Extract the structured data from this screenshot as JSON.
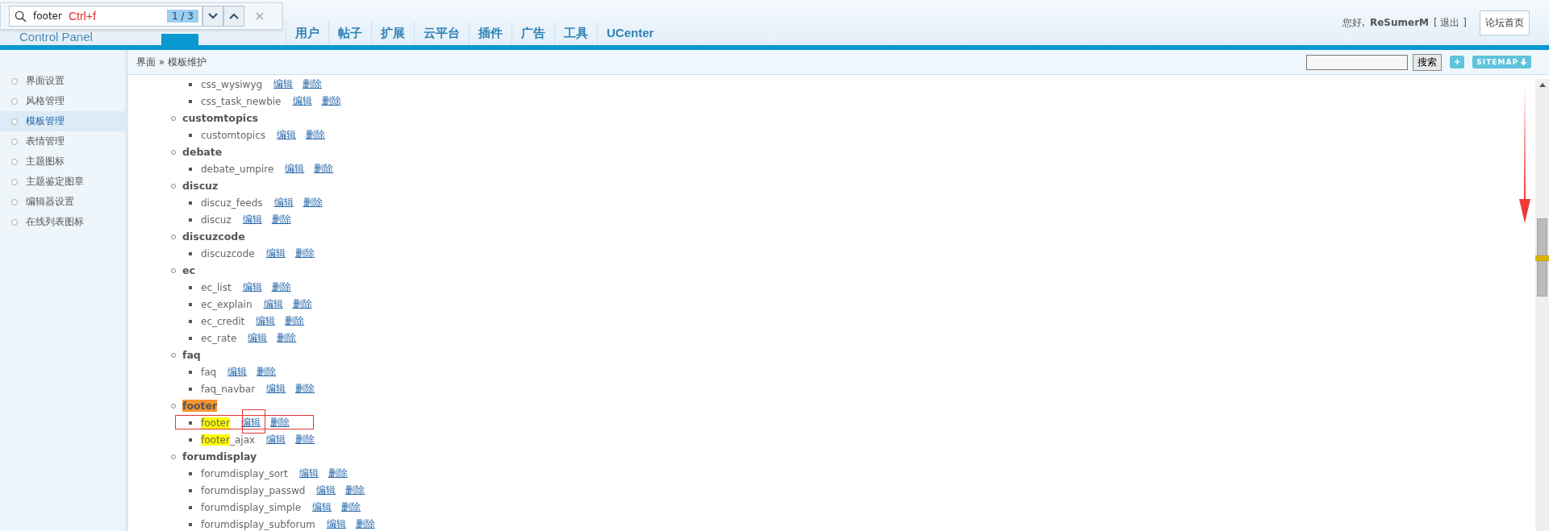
{
  "find_bar": {
    "query": "footer",
    "annotation": "Ctrl+f",
    "match_count": "1 / 3"
  },
  "header": {
    "logo_subtitle": "Control Panel",
    "greeting": "您好,",
    "username": "ReSumerM",
    "logout": "[ 退出 ]",
    "home_button": "论坛首页"
  },
  "nav_tabs": [
    {
      "label": "用户",
      "selected": false
    },
    {
      "label": "帖子",
      "selected": false
    },
    {
      "label": "扩展",
      "selected": false
    },
    {
      "label": "云平台",
      "selected": false
    },
    {
      "label": "插件",
      "selected": false
    },
    {
      "label": "广告",
      "selected": false
    },
    {
      "label": "工具",
      "selected": false
    },
    {
      "label": "UCenter",
      "selected": false
    }
  ],
  "breadcrumb": "界面 » 模板维护",
  "toolbar": {
    "search_button": "搜索",
    "add_button": "+",
    "sitemap_button": "SITEMAP"
  },
  "sidebar": {
    "items": [
      {
        "label": "界面设置",
        "selected": false
      },
      {
        "label": "风格管理",
        "selected": false
      },
      {
        "label": "模板管理",
        "selected": true
      },
      {
        "label": "表情管理",
        "selected": false
      },
      {
        "label": "主题图标",
        "selected": false
      },
      {
        "label": "主题鉴定图章",
        "selected": false
      },
      {
        "label": "编辑器设置",
        "selected": false
      },
      {
        "label": "在线列表图标",
        "selected": false
      }
    ]
  },
  "template_groups": [
    {
      "children": [
        {
          "parts": [
            {
              "text": "css_wysiwyg"
            }
          ],
          "actions": [
            "编辑",
            "删除"
          ]
        },
        {
          "parts": [
            {
              "text": "css_task_newbie"
            }
          ],
          "actions": [
            "编辑",
            "删除"
          ]
        }
      ]
    },
    {
      "parts": [
        {
          "text": "customtopics"
        }
      ],
      "children": [
        {
          "parts": [
            {
              "text": "customtopics"
            }
          ],
          "actions": [
            "编辑",
            "删除"
          ]
        }
      ]
    },
    {
      "parts": [
        {
          "text": "debate"
        }
      ],
      "children": [
        {
          "parts": [
            {
              "text": "debate_umpire"
            }
          ],
          "actions": [
            "编辑",
            "删除"
          ]
        }
      ]
    },
    {
      "parts": [
        {
          "text": "discuz"
        }
      ],
      "children": [
        {
          "parts": [
            {
              "text": "discuz_feeds"
            }
          ],
          "actions": [
            "编辑",
            "删除"
          ]
        },
        {
          "parts": [
            {
              "text": "discuz"
            }
          ],
          "actions": [
            "编辑",
            "删除"
          ]
        }
      ]
    },
    {
      "parts": [
        {
          "text": "discuzcode"
        }
      ],
      "children": [
        {
          "parts": [
            {
              "text": "discuzcode"
            }
          ],
          "actions": [
            "编辑",
            "删除"
          ]
        }
      ]
    },
    {
      "parts": [
        {
          "text": "ec"
        }
      ],
      "children": [
        {
          "parts": [
            {
              "text": "ec_list"
            }
          ],
          "actions": [
            "编辑",
            "删除"
          ]
        },
        {
          "parts": [
            {
              "text": "ec_explain"
            }
          ],
          "actions": [
            "编辑",
            "删除"
          ]
        },
        {
          "parts": [
            {
              "text": "ec_credit"
            }
          ],
          "actions": [
            "编辑",
            "删除"
          ]
        },
        {
          "parts": [
            {
              "text": "ec_rate"
            }
          ],
          "actions": [
            "编辑",
            "删除"
          ]
        }
      ]
    },
    {
      "parts": [
        {
          "text": "faq"
        }
      ],
      "children": [
        {
          "parts": [
            {
              "text": "faq"
            }
          ],
          "actions": [
            "编辑",
            "删除"
          ]
        },
        {
          "parts": [
            {
              "text": "faq_navbar"
            }
          ],
          "actions": [
            "编辑",
            "删除"
          ]
        }
      ]
    },
    {
      "parts": [
        {
          "text": "footer",
          "match": true,
          "current": true
        }
      ],
      "children": [
        {
          "parts": [
            {
              "text": "footer",
              "match": true,
              "current": false
            }
          ],
          "actions": [
            "编辑",
            "删除"
          ],
          "annotated": true,
          "edit_annotated": true
        },
        {
          "parts": [
            {
              "text": "footer",
              "match": true,
              "current": false
            },
            {
              "text": "_ajax"
            }
          ],
          "actions": [
            "编辑",
            "删除"
          ]
        }
      ]
    },
    {
      "parts": [
        {
          "text": "forumdisplay"
        }
      ],
      "children": [
        {
          "parts": [
            {
              "text": "forumdisplay_sort"
            }
          ],
          "actions": [
            "编辑",
            "删除"
          ]
        },
        {
          "parts": [
            {
              "text": "forumdisplay_passwd"
            }
          ],
          "actions": [
            "编辑",
            "删除"
          ]
        },
        {
          "parts": [
            {
              "text": "forumdisplay_simple"
            }
          ],
          "actions": [
            "编辑",
            "删除"
          ]
        },
        {
          "parts": [
            {
              "text": "forumdisplay_subforum"
            }
          ],
          "actions": [
            "编辑",
            "删除"
          ]
        }
      ]
    }
  ]
}
